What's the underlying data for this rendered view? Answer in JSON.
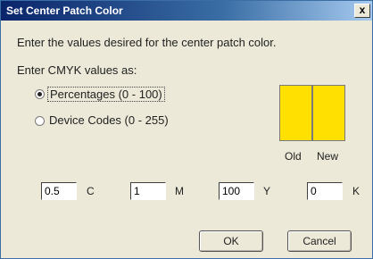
{
  "window": {
    "title": "Set Center Patch Color",
    "close_glyph": "x"
  },
  "instructions": "Enter the values desired for the center patch color.",
  "mode_heading": "Enter CMYK values as:",
  "modes": [
    {
      "label": "Percentages (0 - 100)",
      "selected": true
    },
    {
      "label": "Device Codes (0 - 255)",
      "selected": false
    }
  ],
  "swatches": {
    "old_label": "Old",
    "new_label": "New",
    "old_color": "#ffe000",
    "new_color": "#ffe000"
  },
  "fields": [
    {
      "value": "0.5",
      "label": "C"
    },
    {
      "value": "1",
      "label": "M"
    },
    {
      "value": "100",
      "label": "Y"
    },
    {
      "value": "0",
      "label": "K"
    }
  ],
  "buttons": {
    "ok": "OK",
    "cancel": "Cancel"
  }
}
